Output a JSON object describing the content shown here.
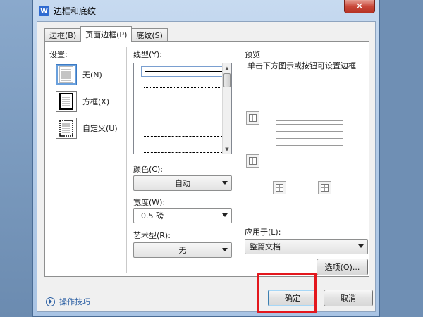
{
  "window": {
    "title": "边框和底纹",
    "app_icon": "W",
    "close_glyph": "✕"
  },
  "tabs": [
    {
      "label": "边框(B)",
      "active": false
    },
    {
      "label": "页面边框(P)",
      "active": true
    },
    {
      "label": "底纹(S)",
      "active": false
    }
  ],
  "settings": {
    "label": "设置:",
    "options": [
      {
        "label": "无(N)",
        "icon": "page-none-icon",
        "selected": true
      },
      {
        "label": "方框(X)",
        "icon": "page-box-icon",
        "selected": false
      },
      {
        "label": "自定义(U)",
        "icon": "page-custom-icon",
        "selected": false
      }
    ]
  },
  "line_style": {
    "label": "线型(Y):",
    "styles": [
      "solid",
      "dotted-fine",
      "dotted",
      "dashed",
      "dash-dot",
      "dash-dot-dot",
      "long-dash"
    ]
  },
  "color": {
    "label": "颜色(C):",
    "value": "自动"
  },
  "width": {
    "label": "宽度(W):",
    "value": "0.5  磅"
  },
  "art": {
    "label": "艺术型(R):",
    "value": "无"
  },
  "preview": {
    "label": "预览",
    "hint": "单击下方图示或按钮可设置边框"
  },
  "apply_to": {
    "label": "应用于(L):",
    "value": "整篇文档"
  },
  "buttons": {
    "options": "选项(O)...",
    "ok": "确定",
    "cancel": "取消"
  },
  "tips": {
    "label": "操作技巧"
  },
  "colors": {
    "highlight": "#e3171d",
    "link": "#2b5fa3",
    "selection": "#3d7bc4"
  }
}
